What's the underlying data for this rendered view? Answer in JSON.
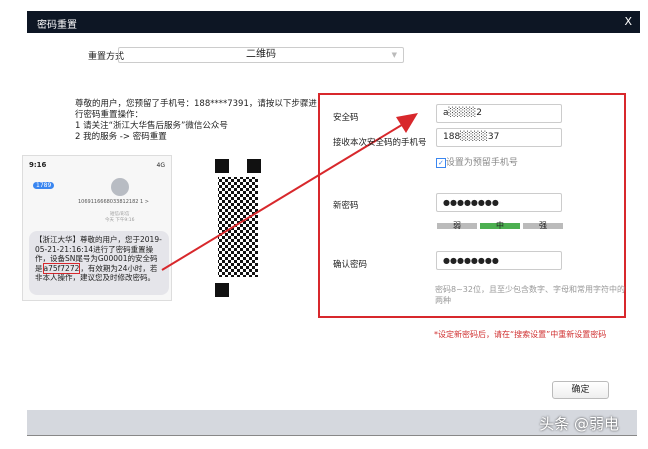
{
  "window": {
    "title": "密码重置",
    "close": "X"
  },
  "reset_method": {
    "label": "重置方式",
    "value": "二维码"
  },
  "instructions": [
    "尊敬的用户，您预留了手机号：188****7391，请按以下步骤进行密码重置操作：",
    "1 请关注“浙江大华售后服务”微信公众号",
    "2 我的服务 -> 密码重置"
  ],
  "phone": {
    "time": "9:16",
    "signal": "4G",
    "back_badge": "1789",
    "sender": "1069116668033812182 1 >",
    "meta": "短信/彩信\n今天 下午9:16",
    "message_pre": "【浙江大华】尊敬的用户，您于2019-05-21-21:16:14进行了密码重置操作，设备SN尾号为G00001的安全码是",
    "code": "a75f7272",
    "message_post": "，有效期为24小时，若非本人操作，建议您及时修改密码。"
  },
  "form": {
    "security_code_label": "安全码",
    "security_code_value": "a░░░░2",
    "phone_label": "接收本次安全码的手机号",
    "phone_value": "188░░░░37",
    "set_reserved_label": "设置为预留手机号",
    "set_reserved_checked": true,
    "new_password_label": "新密码",
    "new_password_value": "●●●●●●●●",
    "strength": [
      "弱",
      "中",
      "强"
    ],
    "strength_level": "中",
    "confirm_label": "确认密码",
    "confirm_value": "●●●●●●●●",
    "hint": "密码8~32位，且至少包含数字、字母和常用字符中的两种"
  },
  "note": "*设定新密码后，请在“搜索设置”中重新设置密码",
  "ok_button": "确定",
  "watermark": "头条 @弱电",
  "colors": {
    "accent_red": "#d8282c",
    "strength_mid": "#4caf50",
    "titlebar": "#0d1624"
  }
}
